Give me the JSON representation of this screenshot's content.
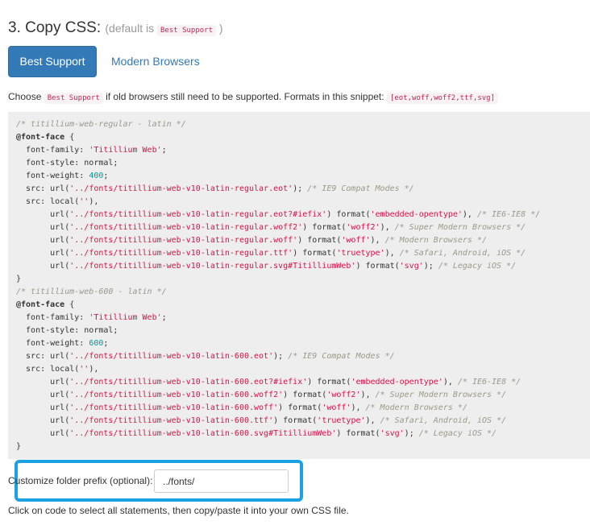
{
  "heading": {
    "title": "3. Copy CSS:",
    "default_prefix": "(default is",
    "default_tag": "Best Support",
    "default_suffix": ")"
  },
  "tabs": [
    {
      "label": "Best Support",
      "active": true
    },
    {
      "label": "Modern Browsers",
      "active": false
    }
  ],
  "choose": {
    "prefix": "Choose",
    "tag": "Best Support",
    "middle": "if old browsers still need to be supported. Formats in this snippet:",
    "formats": "[eot,woff,woff2,ttf,svg]"
  },
  "code_lines": [
    [
      {
        "t": "/* titillium-web-regular - latin */",
        "c": "com"
      }
    ],
    [
      {
        "t": "@font-face",
        "c": "kw"
      },
      {
        "t": " {"
      }
    ],
    [
      {
        "t": "  font-family: "
      },
      {
        "t": "'Titillium Web'",
        "c": "str"
      },
      {
        "t": ";"
      }
    ],
    [
      {
        "t": "  font-style: normal;"
      }
    ],
    [
      {
        "t": "  font-weight: "
      },
      {
        "t": "400",
        "c": "num"
      },
      {
        "t": ";"
      }
    ],
    [
      {
        "t": "  src: url("
      },
      {
        "t": "'../fonts/titillium-web-v10-latin-regular.eot'",
        "c": "str"
      },
      {
        "t": "); "
      },
      {
        "t": "/* IE9 Compat Modes */",
        "c": "com"
      }
    ],
    [
      {
        "t": "  src: local("
      },
      {
        "t": "''",
        "c": "str"
      },
      {
        "t": "),"
      }
    ],
    [
      {
        "t": "       url("
      },
      {
        "t": "'../fonts/titillium-web-v10-latin-regular.eot?#iefix'",
        "c": "str"
      },
      {
        "t": ") format("
      },
      {
        "t": "'embedded-opentype'",
        "c": "str"
      },
      {
        "t": "), "
      },
      {
        "t": "/* IE6-IE8 */",
        "c": "com"
      }
    ],
    [
      {
        "t": "       url("
      },
      {
        "t": "'../fonts/titillium-web-v10-latin-regular.woff2'",
        "c": "str"
      },
      {
        "t": ") format("
      },
      {
        "t": "'woff2'",
        "c": "str"
      },
      {
        "t": "), "
      },
      {
        "t": "/* Super Modern Browsers */",
        "c": "com"
      }
    ],
    [
      {
        "t": "       url("
      },
      {
        "t": "'../fonts/titillium-web-v10-latin-regular.woff'",
        "c": "str"
      },
      {
        "t": ") format("
      },
      {
        "t": "'woff'",
        "c": "str"
      },
      {
        "t": "), "
      },
      {
        "t": "/* Modern Browsers */",
        "c": "com"
      }
    ],
    [
      {
        "t": "       url("
      },
      {
        "t": "'../fonts/titillium-web-v10-latin-regular.ttf'",
        "c": "str"
      },
      {
        "t": ") format("
      },
      {
        "t": "'truetype'",
        "c": "str"
      },
      {
        "t": "), "
      },
      {
        "t": "/* Safari, Android, iOS */",
        "c": "com"
      }
    ],
    [
      {
        "t": "       url("
      },
      {
        "t": "'../fonts/titillium-web-v10-latin-regular.svg#TitilliumWeb'",
        "c": "str"
      },
      {
        "t": ") format("
      },
      {
        "t": "'svg'",
        "c": "str"
      },
      {
        "t": "); "
      },
      {
        "t": "/* Legacy iOS */",
        "c": "com"
      }
    ],
    [
      {
        "t": "}"
      }
    ],
    [
      {
        "t": "/* titillium-web-600 - latin */",
        "c": "com"
      }
    ],
    [
      {
        "t": "@font-face",
        "c": "kw"
      },
      {
        "t": " {"
      }
    ],
    [
      {
        "t": "  font-family: "
      },
      {
        "t": "'Titillium Web'",
        "c": "str"
      },
      {
        "t": ";"
      }
    ],
    [
      {
        "t": "  font-style: normal;"
      }
    ],
    [
      {
        "t": "  font-weight: "
      },
      {
        "t": "600",
        "c": "num"
      },
      {
        "t": ";"
      }
    ],
    [
      {
        "t": "  src: url("
      },
      {
        "t": "'../fonts/titillium-web-v10-latin-600.eot'",
        "c": "str"
      },
      {
        "t": "); "
      },
      {
        "t": "/* IE9 Compat Modes */",
        "c": "com"
      }
    ],
    [
      {
        "t": "  src: local("
      },
      {
        "t": "''",
        "c": "str"
      },
      {
        "t": "),"
      }
    ],
    [
      {
        "t": "       url("
      },
      {
        "t": "'../fonts/titillium-web-v10-latin-600.eot?#iefix'",
        "c": "str"
      },
      {
        "t": ") format("
      },
      {
        "t": "'embedded-opentype'",
        "c": "str"
      },
      {
        "t": "), "
      },
      {
        "t": "/* IE6-IE8 */",
        "c": "com"
      }
    ],
    [
      {
        "t": "       url("
      },
      {
        "t": "'../fonts/titillium-web-v10-latin-600.woff2'",
        "c": "str"
      },
      {
        "t": ") format("
      },
      {
        "t": "'woff2'",
        "c": "str"
      },
      {
        "t": "), "
      },
      {
        "t": "/* Super Modern Browsers */",
        "c": "com"
      }
    ],
    [
      {
        "t": "       url("
      },
      {
        "t": "'../fonts/titillium-web-v10-latin-600.woff'",
        "c": "str"
      },
      {
        "t": ") format("
      },
      {
        "t": "'woff'",
        "c": "str"
      },
      {
        "t": "), "
      },
      {
        "t": "/* Modern Browsers */",
        "c": "com"
      }
    ],
    [
      {
        "t": "       url("
      },
      {
        "t": "'../fonts/titillium-web-v10-latin-600.ttf'",
        "c": "str"
      },
      {
        "t": ") format("
      },
      {
        "t": "'truetype'",
        "c": "str"
      },
      {
        "t": "), "
      },
      {
        "t": "/* Safari, Android, iOS */",
        "c": "com"
      }
    ],
    [
      {
        "t": "       url("
      },
      {
        "t": "'../fonts/titillium-web-v10-latin-600.svg#TitilliumWeb'",
        "c": "str"
      },
      {
        "t": ") format("
      },
      {
        "t": "'svg'",
        "c": "str"
      },
      {
        "t": "); "
      },
      {
        "t": "/* Legacy iOS */",
        "c": "com"
      }
    ],
    [
      {
        "t": "}"
      }
    ]
  ],
  "prefix": {
    "label": "Customize folder prefix (optional):",
    "value": "../fonts/"
  },
  "footnote": "Click on code to select all statements, then copy/paste it into your own CSS file.",
  "colors": {
    "primary": "#337ab7",
    "highlight_border": "#1ba1e2",
    "code_bg": "#eeeeee",
    "tag_text": "#c7254e"
  }
}
